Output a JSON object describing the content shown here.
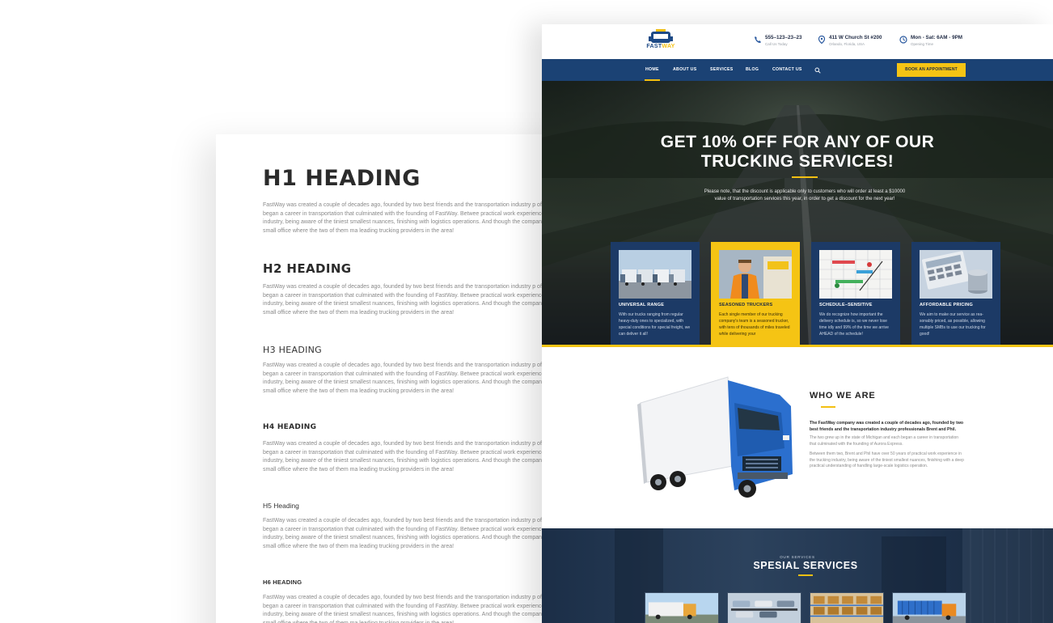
{
  "typography": {
    "h1": "H1 HEADING",
    "h2": "H2 HEADING",
    "h3": "H3 HEADING",
    "h4": "H4 HEADING",
    "h5": "H5 Heading",
    "h6": "H6 HEADING",
    "paragraph": "FastWay was created a couple of decades ago, founded by two best friends and the transportation industry p of Michigan and each began a career in transportation that culminated with the founding of FastWay. Betwee practical work experience in the trucking industry, being aware of the tiniest smallest nuances, finishing with logistics operations. And though the company initially started out in a small office where the two of them ma leading trucking providers in the area!"
  },
  "site": {
    "logo": {
      "brand_a": "FAST",
      "brand_b": "WAY"
    },
    "contacts": [
      {
        "icon": "phone-icon",
        "main": "555–123–23–23",
        "sub": "Call Us Today"
      },
      {
        "icon": "map-pin-icon",
        "main": "411 W Church St #200",
        "sub": "Orlando, Florida, USA"
      },
      {
        "icon": "clock-icon",
        "main": "Mon - Sat: 6AM - 9PM",
        "sub": "Opening Time"
      }
    ],
    "nav": {
      "items": [
        "HOME",
        "ABOUT US",
        "SERVICES",
        "BLOG",
        "CONTACT US"
      ],
      "active": "HOME",
      "search_icon": "search-icon",
      "cta": "BOOK AN APPOINTMENT"
    },
    "hero": {
      "title": "GET 10% OFF FOR ANY OF OUR TRUCKING SERVICES!",
      "text": "Please note, that the discount is applicable only to customers who will order at least a $10000 value of transportation services this year, in order to get a discount for the next year!"
    },
    "cards": [
      {
        "title": "UNIVERSAL RANGE",
        "text": "With our trucks ranging from regular heavy-duty ones to specialized, with special conditions for special freight, we can deliver it all!",
        "highlight": false
      },
      {
        "title": "SEASONED TRUCKERS",
        "text": "Each single member of our trucking company's team is a seasoned trucker, with tens of thousands of miles traveled while delivering your",
        "highlight": true
      },
      {
        "title": "SCHEDULE–SENSITIVE",
        "text": "We do recognize how important the delivery schedule is, so we never lose time idly and 99% of the time we arrive AHEAD of the schedule!",
        "highlight": false
      },
      {
        "title": "AFFORDABLE PRICING",
        "text": "We aim to make our service as rea- sonably priced, as possible, allowing multiple SMBs to use our trucking for good!",
        "highlight": false
      }
    ],
    "who": {
      "title": "WHO WE ARE",
      "lead": "The FastWay company was created a couple of decades ago, founded by two best friends and the transportation industry professionals Brent and Phil.",
      "p1": "The two grew up in the state of Michigan and each began a career in transportation that culminated with the founding of Aurora Express.",
      "p2": "Between them two, Brent and Phil have over 50 years of practical work experience in the trucking industry, being aware of the tiniest smallest nuances, finishing with a deep practical understanding of handling large-scale logistics operation."
    },
    "services": {
      "kicker": "OUR SERVICES",
      "title": "SPESIAL SERVICES"
    }
  }
}
